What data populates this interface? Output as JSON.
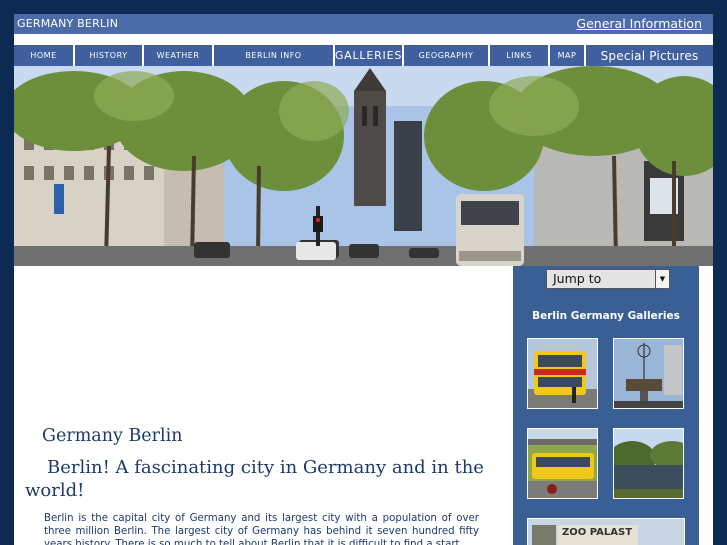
{
  "header": {
    "site_title": "GERMANY BERLIN",
    "general_info": "General Information"
  },
  "nav": {
    "items": [
      "HOME",
      "HISTORY",
      "WEATHER",
      "BERLIN INFO",
      "GALLERIES",
      "GEOGRAPHY",
      "LINKS",
      "MAP",
      "Special Pictures"
    ]
  },
  "content": {
    "title": "Germany Berlin",
    "subtitle": "Berlin! A fascinating city in Germany and in the world!",
    "paragraph": "Berlin is the capital city of Germany and its largest city with a population of over three million Berlin. The largest city of Germany has behind it seven hundred fifty years history. There is so much to tell about Berlin that it is difficult to find a start."
  },
  "sidebar": {
    "jump_to": "Jump to",
    "galleries_title": "Berlin Germany Galleries",
    "thumb_sign": "ZOO PALAST"
  },
  "colors": {
    "background": "#0d2a52",
    "bar": "#4a6aa8",
    "nav": "#3f5f9e",
    "sidebar": "#3a5f95",
    "heading": "#1c3a6a"
  }
}
